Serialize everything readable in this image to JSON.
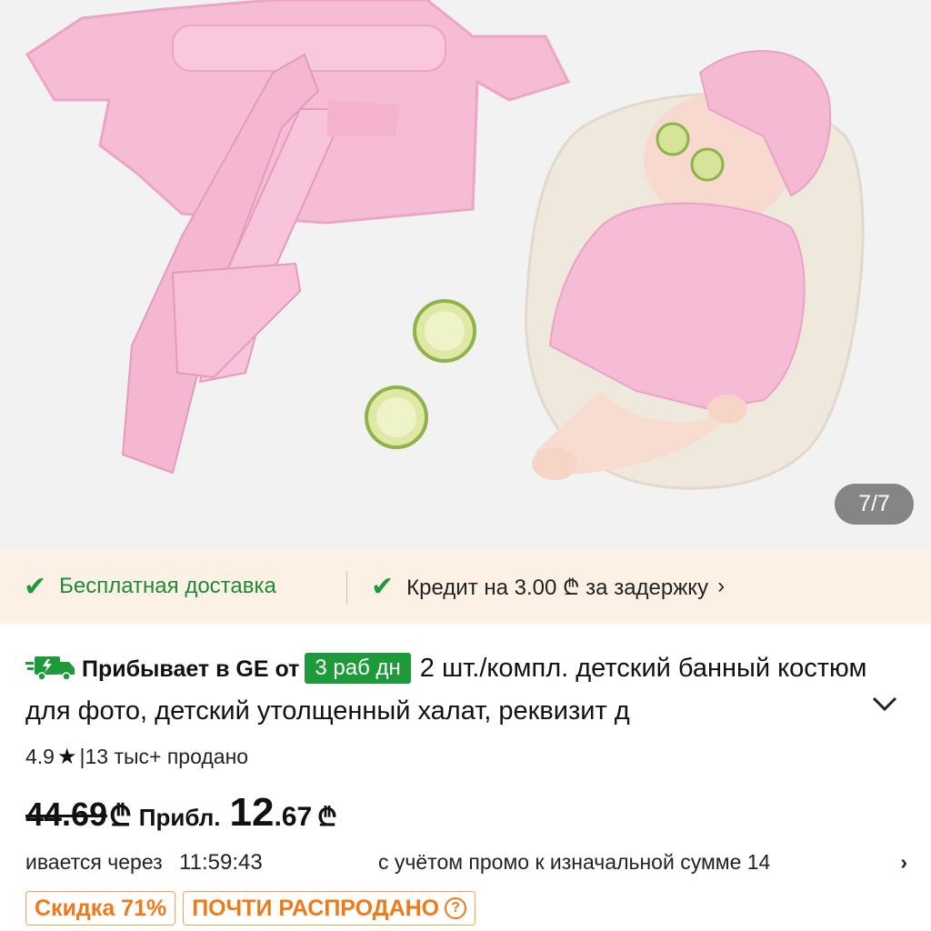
{
  "gallery": {
    "counter": "7/7"
  },
  "benefits": {
    "free_shipping": "Бесплатная доставка",
    "credit": "Кредит на 3.00 ₾ за задержку"
  },
  "product": {
    "arrival_prefix": "Прибывает в GE от",
    "arrival_badge": "3 раб дн",
    "title_visible": "2 шт./компл. детский банный костюм для фото, детский утолщенный халат, реквизит д",
    "rating": "4.9",
    "sold": "|13 тыс+ продано",
    "old_price": "44.69",
    "currency": "₾",
    "approx_label": "Прибл.",
    "new_price_int": "12",
    "new_price_dec": ".67",
    "timer_label": "ивается через",
    "timer": "11:59:43",
    "promo_note": "с учётом промо к изначальной сумме 14",
    "discount_tag": "Скидка 71%",
    "stock_tag": "ПОЧТИ РАСПРОДАНО"
  },
  "colors": {
    "green": "#1f9a3a",
    "orange": "#f07a1a",
    "strip_bg": "#fdf1e6"
  }
}
